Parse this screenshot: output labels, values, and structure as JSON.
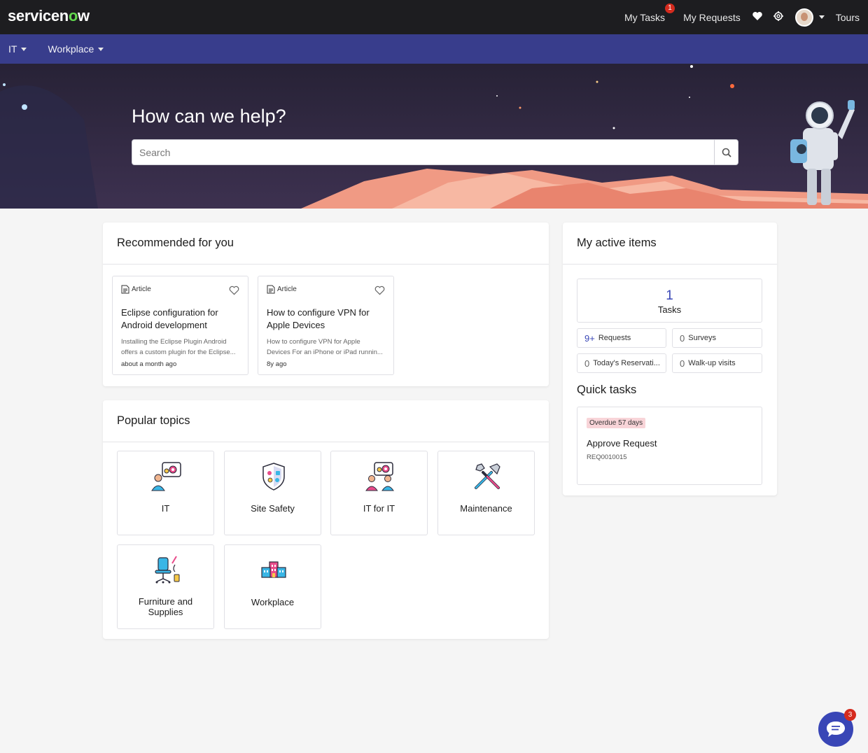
{
  "header": {
    "logo_prefix": "servicen",
    "logo_o": "o",
    "logo_suffix": "w",
    "my_tasks": "My Tasks",
    "my_tasks_badge": "1",
    "my_requests": "My Requests",
    "tours": "Tours"
  },
  "subnav": {
    "items": [
      {
        "label": "IT"
      },
      {
        "label": "Workplace"
      }
    ]
  },
  "hero": {
    "title": "How can we help?",
    "search_placeholder": "Search"
  },
  "recommended": {
    "title": "Recommended for you",
    "articles": [
      {
        "type": "Article",
        "title": "Eclipse configuration for Android development",
        "desc": "Installing the Eclipse Plugin Android offers a custom plugin for the Eclipse...",
        "time": "about a month ago"
      },
      {
        "type": "Article",
        "title": "How to configure VPN for Apple Devices",
        "desc": "How to configure VPN for Apple Devices For an iPhone or iPad runnin...",
        "time": "8y ago"
      }
    ]
  },
  "popular": {
    "title": "Popular topics",
    "topics": [
      {
        "label": "IT",
        "icon": "it-support-icon"
      },
      {
        "label": "Site Safety",
        "icon": "shield-icon"
      },
      {
        "label": "IT for IT",
        "icon": "it-team-icon"
      },
      {
        "label": "Maintenance",
        "icon": "tools-icon"
      },
      {
        "label": "Furniture and Supplies",
        "icon": "office-chair-icon"
      },
      {
        "label": "Workplace",
        "icon": "buildings-icon"
      }
    ]
  },
  "active_items": {
    "title": "My active items",
    "tasks_count": "1",
    "tasks_label": "Tasks",
    "stats": [
      {
        "n": "9+",
        "label": "Requests"
      },
      {
        "n": "0",
        "label": "Surveys"
      },
      {
        "n": "0",
        "label": "Today's Reservati..."
      },
      {
        "n": "0",
        "label": "Walk-up visits"
      }
    ],
    "quick_title": "Quick tasks",
    "quick_task": {
      "overdue": "Overdue 57 days",
      "title": "Approve Request",
      "number": "REQ0010015"
    }
  },
  "chat": {
    "badge": "3"
  },
  "colors": {
    "topbar": "#1d1d20",
    "subnav": "#383d8c",
    "accent": "#3946b6",
    "badge": "#d52b1e"
  }
}
